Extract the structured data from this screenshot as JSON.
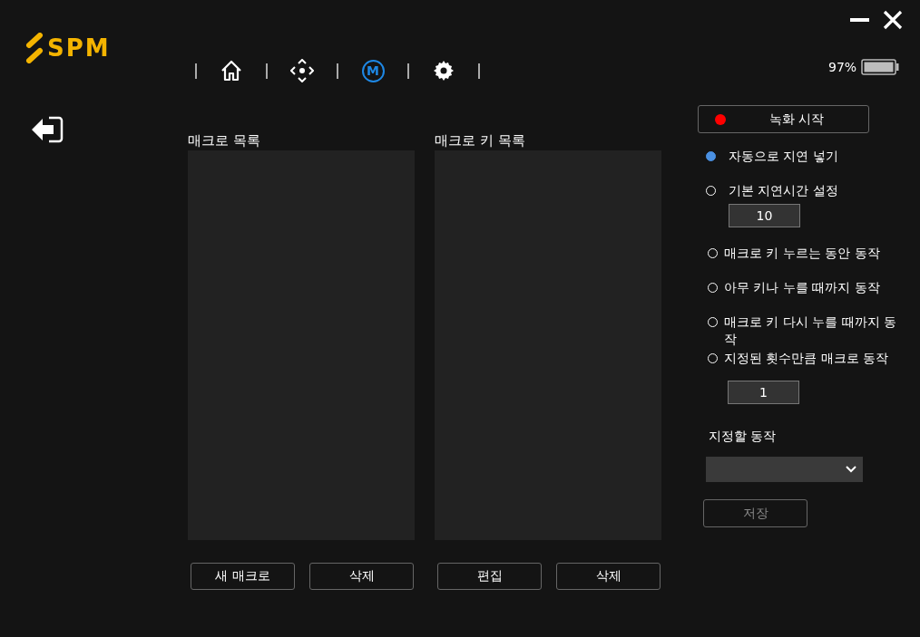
{
  "logo": "SPM",
  "nav": [
    {
      "kind": "home",
      "selected": false
    },
    {
      "kind": "move",
      "selected": false
    },
    {
      "kind": "macro",
      "glyph": "M",
      "selected": true
    },
    {
      "kind": "settings",
      "selected": false
    }
  ],
  "battery": {
    "reading": "97%"
  },
  "panels": [
    {
      "title": "매크로 목록",
      "buttons": [
        "새 매크로",
        "삭제"
      ]
    },
    {
      "title": "매크로 키 목록",
      "buttons": [
        "편집",
        "삭제"
      ]
    }
  ],
  "record_button": {
    "label": "녹화 시작"
  },
  "delay_options": [
    {
      "label": "자동으로 지연 넣기",
      "selected": true
    },
    {
      "label": "기본 지연시간 설정",
      "selected": false,
      "value": "10"
    }
  ],
  "repeat_options": [
    {
      "label": "매크로 키 누르는 동안 동작",
      "selected": false
    },
    {
      "label": "아무 키나 누를 때까지 동작",
      "selected": false
    },
    {
      "label": "매크로 키 다시 누를 때까지 동작",
      "selected": false
    },
    {
      "label": "지정된 횟수만큼 매크로 동작",
      "selected": false,
      "value": "1"
    }
  ],
  "action": {
    "label": "지정할 동작"
  },
  "save_button": {
    "label": "저장",
    "disabled": true
  }
}
